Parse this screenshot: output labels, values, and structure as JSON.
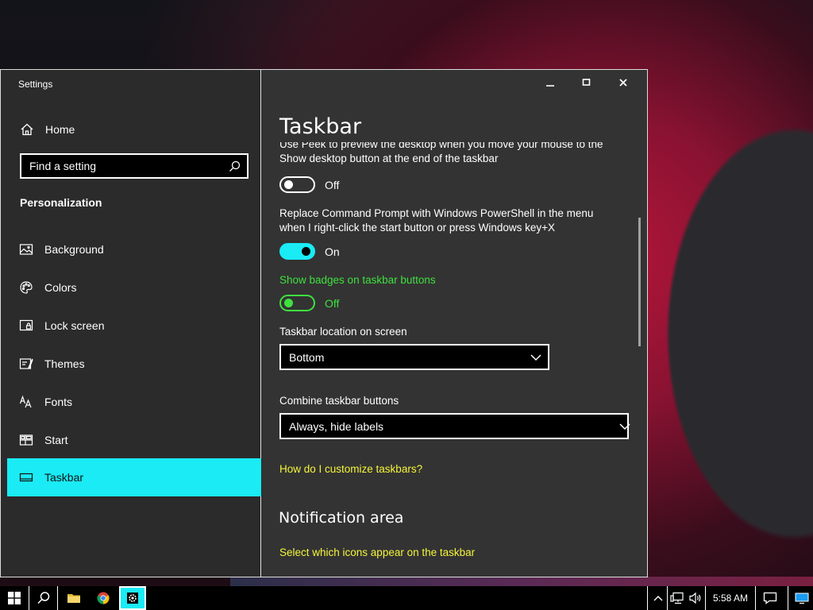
{
  "window": {
    "title": "Settings"
  },
  "sidebar": {
    "home_label": "Home",
    "search_placeholder": "Find a setting",
    "section_label": "Personalization",
    "items": [
      {
        "label": "Background",
        "icon": "image-icon"
      },
      {
        "label": "Colors",
        "icon": "palette-icon"
      },
      {
        "label": "Lock screen",
        "icon": "lock-screen-icon"
      },
      {
        "label": "Themes",
        "icon": "themes-icon"
      },
      {
        "label": "Fonts",
        "icon": "fonts-icon"
      },
      {
        "label": "Start",
        "icon": "start-icon"
      },
      {
        "label": "Taskbar",
        "icon": "taskbar-icon",
        "active": true
      }
    ]
  },
  "content": {
    "title": "Taskbar",
    "peek": {
      "description_line1": "Use Peek to preview the desktop when you move your mouse to the",
      "description_line2": "Show desktop button at the end of the taskbar",
      "state": "Off"
    },
    "powershell": {
      "description_line1": "Replace Command Prompt with Windows PowerShell in the menu",
      "description_line2": "when I right-click the start button or press Windows key+X",
      "state": "On"
    },
    "badges": {
      "label": "Show badges on taskbar buttons",
      "state": "Off"
    },
    "location": {
      "label": "Taskbar location on screen",
      "value": "Bottom"
    },
    "combine": {
      "label": "Combine taskbar buttons",
      "value": "Always, hide labels"
    },
    "help_link": "How do I customize taskbars?",
    "notification_heading": "Notification area",
    "notification_link": "Select which icons appear on the taskbar"
  },
  "taskbar": {
    "clock": "5:58 AM",
    "pinned": [
      "start-icon",
      "search-icon",
      "file-explorer-icon",
      "chrome-icon",
      "settings-icon"
    ]
  },
  "colors": {
    "accent": "#1aebf5",
    "link_yellow": "#f5f53c",
    "highlight_green": "#3fe03f",
    "window_bg": "#2b2b2b"
  }
}
